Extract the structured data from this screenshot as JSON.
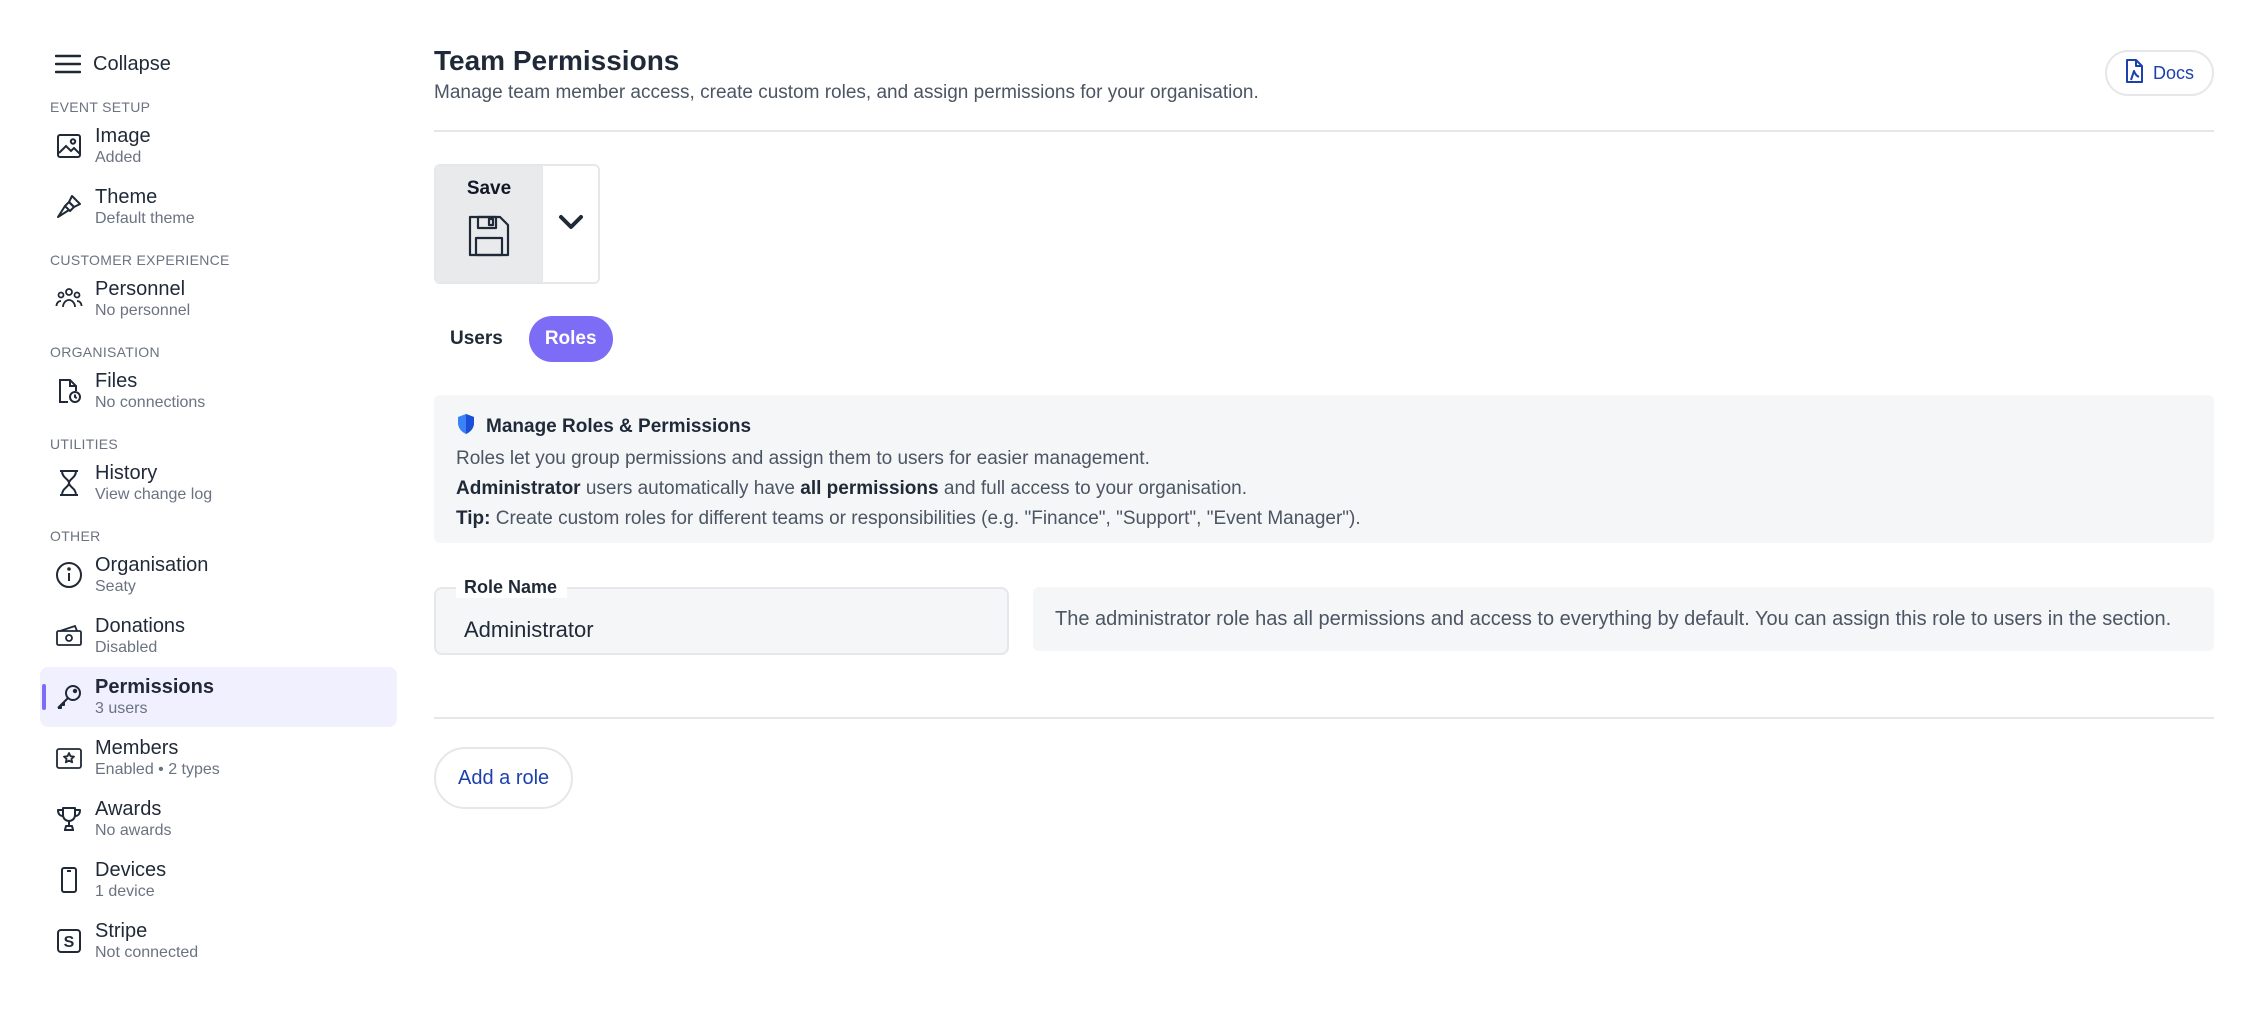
{
  "sidebar": {
    "collapse_label": "Collapse",
    "sections": [
      {
        "title": "EVENT SETUP",
        "items": [
          {
            "name": "image",
            "icon": "image-icon",
            "title": "Image",
            "sub": "Added"
          },
          {
            "name": "theme",
            "icon": "paintbrush-icon",
            "title": "Theme",
            "sub": "Default theme"
          }
        ]
      },
      {
        "title": "CUSTOMER EXPERIENCE",
        "items": [
          {
            "name": "personnel",
            "icon": "people-icon",
            "title": "Personnel",
            "sub": "No personnel"
          }
        ]
      },
      {
        "title": "ORGANISATION",
        "items": [
          {
            "name": "files",
            "icon": "file-clock-icon",
            "title": "Files",
            "sub": "No connections"
          }
        ]
      },
      {
        "title": "UTILITIES",
        "items": [
          {
            "name": "history",
            "icon": "hourglass-icon",
            "title": "History",
            "sub": "View change log"
          }
        ]
      },
      {
        "title": "OTHER",
        "items": [
          {
            "name": "organisation",
            "icon": "info-icon",
            "title": "Organisation",
            "sub": "Seaty"
          },
          {
            "name": "donations",
            "icon": "cash-icon",
            "title": "Donations",
            "sub": "Disabled"
          },
          {
            "name": "permissions",
            "icon": "key-icon",
            "title": "Permissions",
            "sub": "3 users",
            "active": true
          },
          {
            "name": "members",
            "icon": "star-card-icon",
            "title": "Members",
            "sub": "Enabled • 2 types"
          },
          {
            "name": "awards",
            "icon": "trophy-icon",
            "title": "Awards",
            "sub": "No awards"
          },
          {
            "name": "devices",
            "icon": "phone-icon",
            "title": "Devices",
            "sub": "1 device"
          },
          {
            "name": "stripe",
            "icon": "stripe-icon",
            "title": "Stripe",
            "sub": "Not connected"
          }
        ]
      }
    ]
  },
  "header": {
    "title": "Team Permissions",
    "subtitle": "Manage team member access, create custom roles, and assign permissions for your organisation.",
    "docs_label": "Docs"
  },
  "save": {
    "label": "Save"
  },
  "tabs": [
    {
      "label": "Users",
      "active": false
    },
    {
      "label": "Roles",
      "active": true
    }
  ],
  "info": {
    "title": "Manage Roles & Permissions",
    "line1": "Roles let you group permissions and assign them to users for easier management.",
    "line2_b1": "Administrator",
    "line2_t1": " users automatically have ",
    "line2_b2": "all permissions",
    "line2_t2": " and full access to your organisation.",
    "line3_b": "Tip:",
    "line3_t": " Create custom roles for different teams or responsibilities (e.g. \"Finance\", \"Support\", \"Event Manager\")."
  },
  "role": {
    "field_label": "Role Name",
    "value": "Administrator",
    "description": "The administrator role has all permissions and access to everything by default. You can assign this role to users in the section."
  },
  "add_role_label": "Add a role",
  "colors": {
    "accent": "#7c6cf6",
    "link": "#1e40af",
    "shield": "#3b82f6"
  }
}
